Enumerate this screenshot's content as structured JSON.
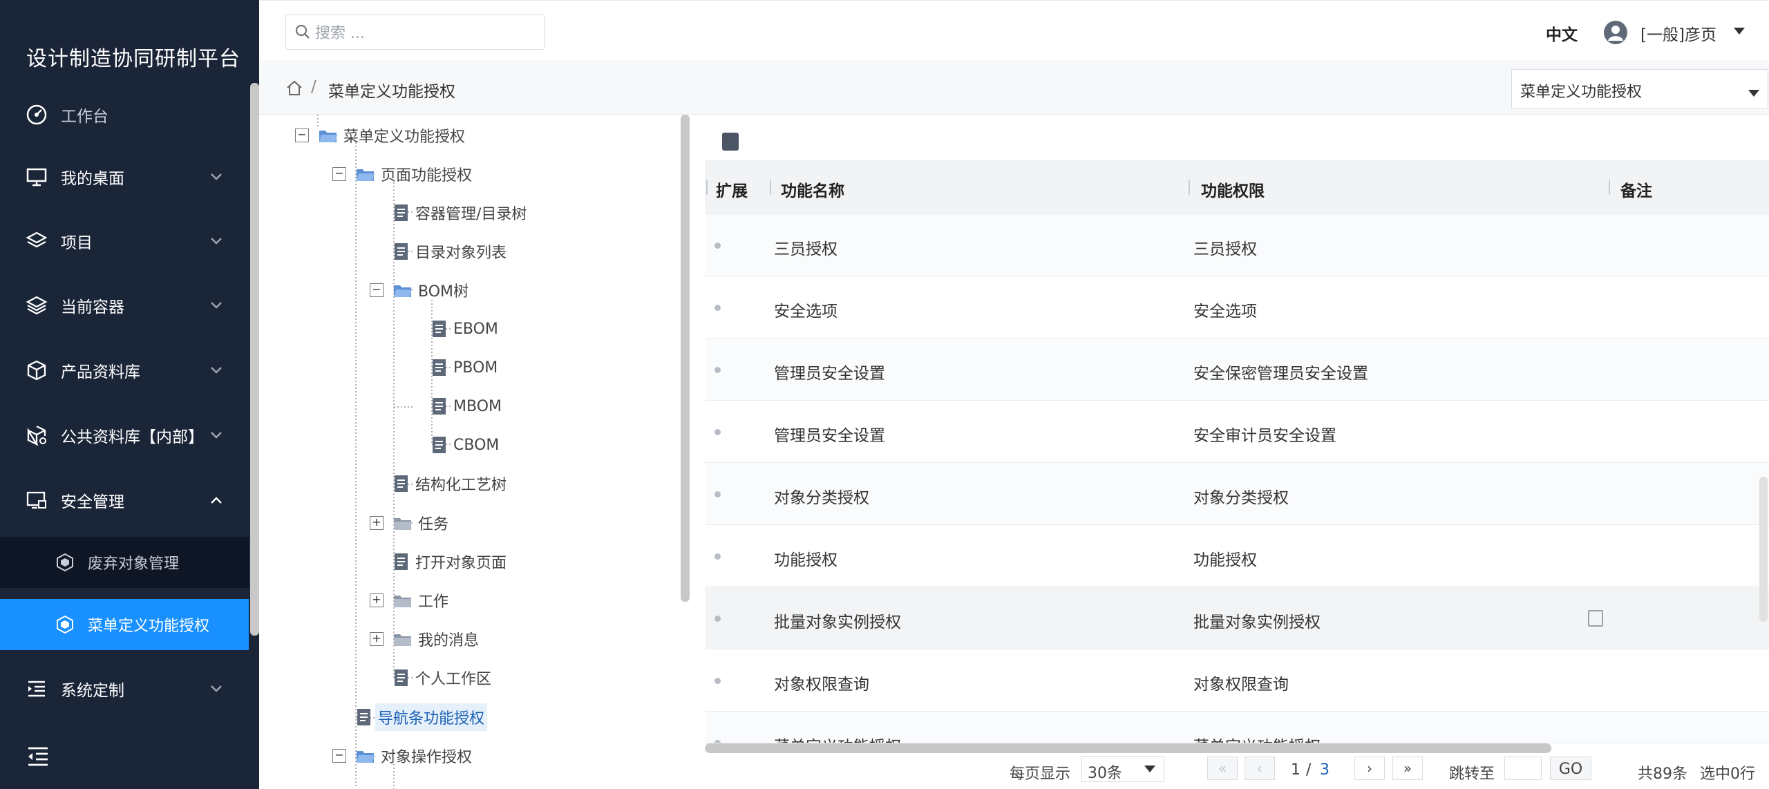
{
  "app": {
    "title": "设计制造协同研制平台"
  },
  "sidebar": {
    "items": [
      {
        "label": "工作台",
        "icon": "dashboard-icon"
      },
      {
        "label": "我的桌面",
        "icon": "monitor-icon"
      },
      {
        "label": "项目",
        "icon": "layers-icon"
      },
      {
        "label": "当前容器",
        "icon": "container-icon"
      },
      {
        "label": "产品资料库",
        "icon": "cube-icon"
      },
      {
        "label": "公共资料库【内部】",
        "icon": "cube-shared-icon"
      },
      {
        "label": "安全管理",
        "icon": "security-icon"
      },
      {
        "label": "系统定制",
        "icon": "list-indent-icon"
      }
    ],
    "subitems": [
      {
        "label": "废弃对象管理",
        "icon": "hexagon-icon"
      },
      {
        "label": "菜单定义功能授权",
        "icon": "hexagon-icon"
      }
    ]
  },
  "header": {
    "search_placeholder": "搜索 ...",
    "lang": "中文",
    "user": "[一般]彦页"
  },
  "breadcrumb": {
    "separator": "/",
    "current": "菜单定义功能授权",
    "select_value": "菜单定义功能授权"
  },
  "tree": {
    "nodes": [
      "菜单定义功能授权",
      "页面功能授权",
      "容器管理/目录树",
      "目录对象列表",
      "BOM树",
      "EBOM",
      "PBOM",
      "MBOM",
      "CBOM",
      "结构化工艺树",
      "任务",
      "打开对象页面",
      "工作",
      "我的消息",
      "个人工作区",
      "导航条功能授权",
      "对象操作授权"
    ]
  },
  "table": {
    "headers": [
      "扩展",
      "功能名称",
      "功能权限",
      "备注"
    ],
    "rows": [
      [
        "三员授权",
        "三员授权"
      ],
      [
        "安全选项",
        "安全选项"
      ],
      [
        "管理员安全设置",
        "安全保密管理员安全设置"
      ],
      [
        "管理员安全设置",
        "安全审计员安全设置"
      ],
      [
        "对象分类授权",
        "对象分类授权"
      ],
      [
        "功能授权",
        "功能授权"
      ],
      [
        "批量对象实例授权",
        "批量对象实例授权"
      ],
      [
        "对象权限查询",
        "对象权限查询"
      ],
      [
        "菜单定义功能授权",
        "菜单定义功能授权"
      ]
    ]
  },
  "pager": {
    "per_page_label": "每页显示",
    "per_page": "30条",
    "current": "1",
    "slash": "/",
    "total_pages": "3",
    "jump_label": "跳转至",
    "go": "GO",
    "total": "共89条",
    "selected": "选中0行"
  },
  "colors": {
    "sidebar": "#1b2538",
    "active": "#1890ff",
    "link": "#1a5fb4"
  }
}
